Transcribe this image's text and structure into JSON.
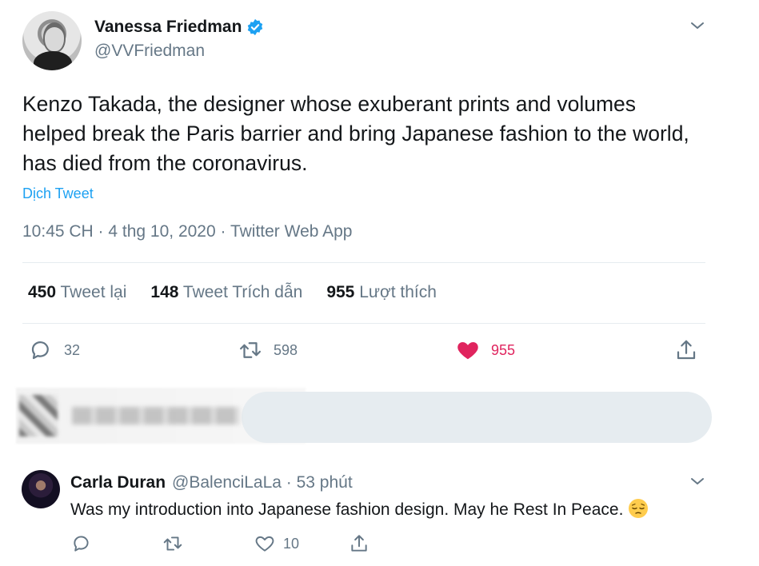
{
  "tweet": {
    "author_name": "Vanessa Friedman",
    "author_handle": "@VVFriedman",
    "text": "Kenzo Takada, the designer whose exuberant prints and volumes helped break the Paris barrier and bring Japanese fashion to the world, has died from the coronavirus.",
    "translate_label": "Dịch Tweet",
    "meta": "10:45 CH · 4 thg 10, 2020 · Twitter Web App",
    "stats": {
      "retweets_count": "450",
      "retweets_label": "Tweet lại",
      "quotes_count": "148",
      "quotes_label": "Tweet Trích dẫn",
      "likes_count": "955",
      "likes_label": "Lượt thích"
    },
    "actions": {
      "reply_count": "32",
      "retweet_count": "598",
      "like_count": "955"
    }
  },
  "reply": {
    "author_name": "Carla Duran",
    "author_handle": "@BalenciLaLa · 53 phút",
    "text": "Was my introduction into Japanese fashion design. May he Rest In Peace.",
    "emoji": "pensive-face-emoji",
    "actions": {
      "like_count": "10"
    }
  },
  "colors": {
    "accent": "#1da1f2",
    "like": "#e0245e",
    "muted": "#657786"
  }
}
